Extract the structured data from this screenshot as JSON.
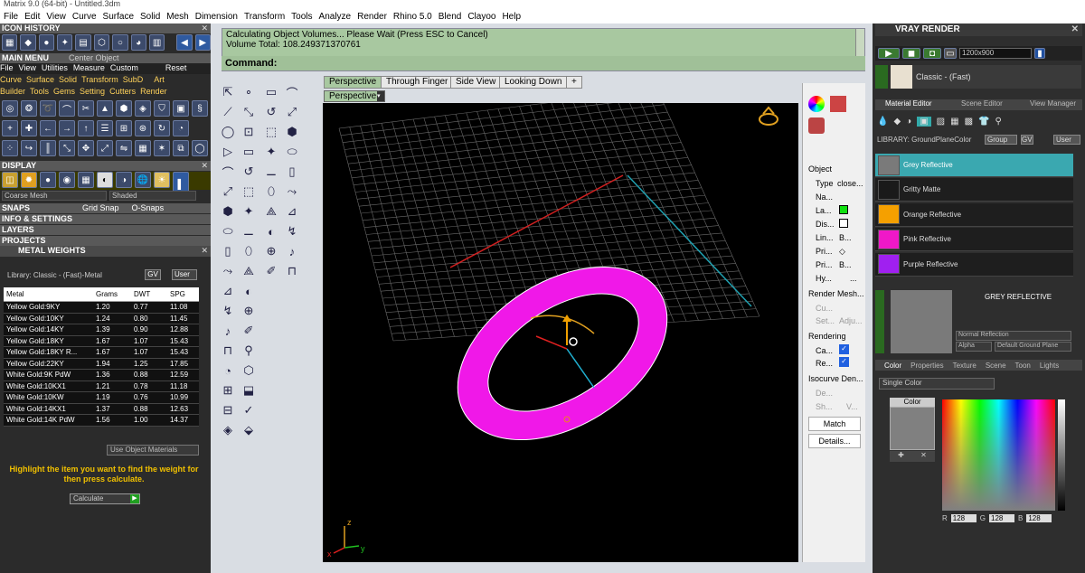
{
  "window": {
    "title": "Matrix 9.0 (64-bit) - Untitled.3dm"
  },
  "menu": [
    "File",
    "Edit",
    "View",
    "Curve",
    "Surface",
    "Solid",
    "Mesh",
    "Dimension",
    "Transform",
    "Tools",
    "Analyze",
    "Render",
    "Rhino 5.0",
    "Blend",
    "Clayoo",
    "Help"
  ],
  "left": {
    "icon_history": "ICON HISTORY",
    "main_menu": "MAIN MENU",
    "center_object": "Center Object",
    "submenu": [
      "File",
      "View",
      "Utilities",
      "Measure",
      "Custom"
    ],
    "reset": "Reset",
    "cats1": [
      "Curve",
      "Surface",
      "Solid",
      "Transform",
      "SubD",
      "Art"
    ],
    "cats2": [
      "Builder",
      "Tools",
      "Gems",
      "Setting",
      "Cutters",
      "Render"
    ],
    "display": "DISPLAY",
    "mesh_mode": "Coarse Mesh",
    "shade_mode": "Shaded",
    "snaps": "SNAPS",
    "grid_snap": "Grid Snap",
    "osnaps": "O-Snaps",
    "info": "INFO & SETTINGS",
    "layers": "LAYERS",
    "projects": "PROJECTS",
    "metal_weights": "METAL WEIGHTS",
    "library": "Library: Classic - (Fast)-Metal",
    "gv": "GV",
    "user": "User",
    "table": {
      "headers": [
        "Metal",
        "Grams",
        "DWT",
        "SPG"
      ],
      "rows": [
        [
          "Yellow Gold:9KY",
          "1.20",
          "0.77",
          "11.08"
        ],
        [
          "Yellow Gold:10KY",
          "1.24",
          "0.80",
          "11.45"
        ],
        [
          "Yellow Gold:14KY",
          "1.39",
          "0.90",
          "12.88"
        ],
        [
          "Yellow Gold:18KY",
          "1.67",
          "1.07",
          "15.43"
        ],
        [
          "Yellow Gold:18KY R...",
          "1.67",
          "1.07",
          "15.43"
        ],
        [
          "Yellow Gold:22KY",
          "1.94",
          "1.25",
          "17.85"
        ],
        [
          "White Gold:9K PdW",
          "1.36",
          "0.88",
          "12.59"
        ],
        [
          "White Gold:10KX1",
          "1.21",
          "0.78",
          "11.18"
        ],
        [
          "White Gold:10KW",
          "1.19",
          "0.76",
          "10.99"
        ],
        [
          "White Gold:14KX1",
          "1.37",
          "0.88",
          "12.63"
        ],
        [
          "White Gold:14K PdW",
          "1.56",
          "1.00",
          "14.37"
        ]
      ]
    },
    "use_obj_materials": "Use Object Materials",
    "hint": "Highlight the item you want to find the weight for then press calculate.",
    "calculate": "Calculate"
  },
  "command": {
    "line1": "Calculating Object Volumes... Please Wait (Press ESC to Cancel)",
    "line2": "Volume Total: 108.249371370761",
    "prompt": "Command:"
  },
  "viewport": {
    "tabs": [
      "Perspective",
      "Through Finger",
      "Side View",
      "Looking Down"
    ],
    "active_label": "Perspective",
    "axis": {
      "z": "z",
      "y": "y",
      "x": "x"
    }
  },
  "props": {
    "object": "Object",
    "type_label": "Type",
    "type_val": "close...",
    "name_label": "Na...",
    "layer_label": "La...",
    "display_label": "Dis...",
    "linetype_label": "Lin...",
    "linetype_val": "B...",
    "print_label": "Pri...",
    "print_val": "B...",
    "print2_label": "Pri...",
    "print2_val": "B...",
    "hyper_label": "Hy...",
    "hyper_val": "...",
    "render_mesh": "Render Mesh...",
    "cu": "Cu...",
    "set": "Set...",
    "adju": "Adju...",
    "rendering": "Rendering",
    "ca": "Ca...",
    "re": "Re...",
    "isocurve": "Isocurve Den...",
    "de": "De...",
    "sh": "Sh...",
    "v": "V...",
    "match": "Match",
    "details": "Details..."
  },
  "right": {
    "title": "VRAY RENDER",
    "resolution": "1200x900",
    "preset": "Classic - (Fast)",
    "tabs": [
      "Material Editor",
      "Scene Editor",
      "View Manager"
    ],
    "library": "LIBRARY: GroundPlaneColor",
    "group": "Group",
    "gv": "GV",
    "user": "User",
    "materials": [
      {
        "name": "Grey Reflective",
        "color": "#7a7a7a"
      },
      {
        "name": "Gritty Matte",
        "color": "#1a1a1a"
      },
      {
        "name": "Orange Reflective",
        "color": "#f5a000"
      },
      {
        "name": "Pink Reflective",
        "color": "#f018c8"
      },
      {
        "name": "Purple Reflective",
        "color": "#a020f0"
      }
    ],
    "selected_material": "GREY REFLECTIVE",
    "reflection": "Normal Reflection",
    "alpha": "Alpha",
    "ground": "Default Ground Plane",
    "subtabs": [
      "Color",
      "Properties",
      "Texture",
      "Scene",
      "Toon",
      "Lights"
    ],
    "single_color": "Single Color",
    "color_label": "Color",
    "r": "128",
    "g": "128",
    "b": "128",
    "r_label": "R",
    "g_label": "G",
    "b_label": "B"
  }
}
